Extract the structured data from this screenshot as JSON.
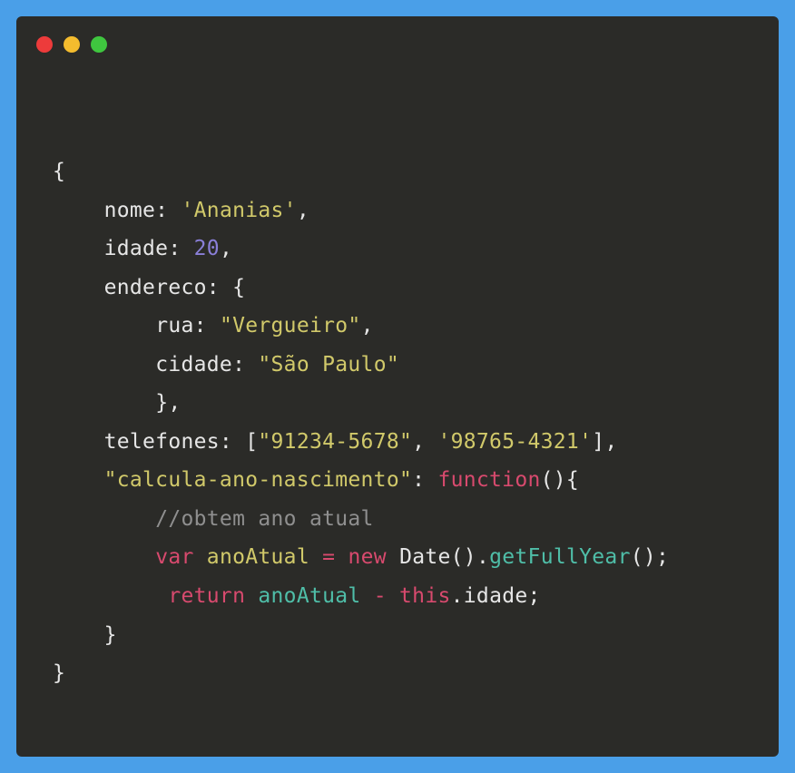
{
  "window": {
    "traffic_lights": {
      "close": "close",
      "minimize": "minimize",
      "zoom": "zoom"
    }
  },
  "code": {
    "line1": "{",
    "line2": {
      "indent": "    ",
      "key": "nome:",
      "sp": " ",
      "val": "'Ananias'",
      "end": ","
    },
    "line3": {
      "indent": "    ",
      "key": "idade:",
      "sp": " ",
      "val": "20",
      "end": ","
    },
    "line4": {
      "indent": "    ",
      "key": "endereco:",
      "sp": " ",
      "brace": "{"
    },
    "line5": {
      "indent": "        ",
      "key": "rua:",
      "sp": " ",
      "val": "\"Vergueiro\"",
      "end": ","
    },
    "line6": {
      "indent": "        ",
      "key": "cidade:",
      "sp": " ",
      "val": "\"São Paulo\""
    },
    "line7": {
      "indent": "        ",
      "brace": "},"
    },
    "line8": {
      "indent": "    ",
      "key": "telefones:",
      "sp": " [",
      "val1": "\"91234-5678\"",
      "comma": ", ",
      "val2": "'98765-4321'",
      "end": "],"
    },
    "line9": {
      "indent": "    ",
      "key": "\"calcula-ano-nascimento\"",
      "colon": ": ",
      "func": "function",
      "parens": "(){"
    },
    "line10": {
      "indent": "        ",
      "comment": "//obtem ano atual"
    },
    "line11": {
      "indent": "        ",
      "var": "var",
      "sp1": " ",
      "name": "anoAtual",
      "sp2": " ",
      "eq": "=",
      "sp3": " ",
      "new": "new",
      "sp4": " ",
      "date": "Date",
      "paren1": "().",
      "method": "getFullYear",
      "paren2": "();"
    },
    "line12": {
      "indent": "         ",
      "ret": "return",
      "sp1": " ",
      "name": "anoAtual",
      "sp2": " ",
      "op": "-",
      "sp3": " ",
      "this": "this",
      "dot": ".",
      "prop": "idade",
      "end": ";"
    },
    "line13": {
      "indent": "    ",
      "brace": "}"
    },
    "line14": "}"
  }
}
